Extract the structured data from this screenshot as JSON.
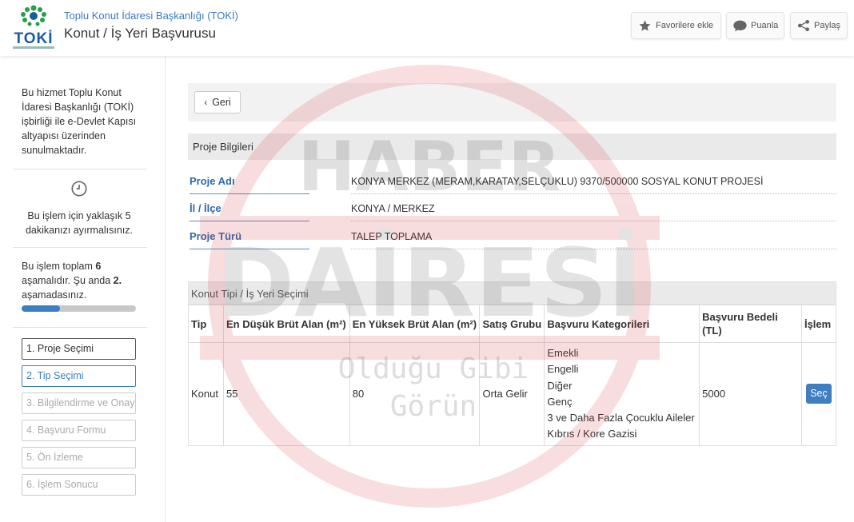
{
  "header": {
    "logo_text": "TOKİ",
    "org_name": "Toplu Konut İdaresi Başkanlığı (TOKİ)",
    "page_title": "Konut / İş Yeri Başvurusu",
    "buttons": {
      "favorite": "Favorilere ekle",
      "rate": "Puanla",
      "share": "Paylaş"
    }
  },
  "sidebar": {
    "service_info": "Bu hizmet Toplu Konut İdaresi Başkanlığı (TOKİ) işbirliği ile e-Devlet Kapısı altyapısı üzerinden sunulmaktadır.",
    "time_info": "Bu işlem için yaklaşık 5 dakikanızı ayırmalısınız.",
    "steps_text_prefix": "Bu işlem toplam ",
    "steps_total": "6",
    "steps_text_middle": " aşamalıdır. Şu anda ",
    "steps_current": "2.",
    "steps_text_suffix": " aşamadasınız.",
    "progress_fraction": 0.333,
    "steps": [
      {
        "label": "1. Proje Seçimi",
        "state": "done"
      },
      {
        "label": "2. Tip Seçimi",
        "state": "active"
      },
      {
        "label": "3. Bilgilendirme ve Onay",
        "state": "pending"
      },
      {
        "label": "4. Başvuru Formu",
        "state": "pending"
      },
      {
        "label": "5. Ön İzleme",
        "state": "pending"
      },
      {
        "label": "6. İşlem Sonucu",
        "state": "pending"
      }
    ]
  },
  "main": {
    "back_label": "Geri",
    "project_section_title": "Proje Bilgileri",
    "project": {
      "name_label": "Proje Adı",
      "name_value": "KONYA MERKEZ (MERAM,KARATAY,SELÇUKLU) 9370/500000 SOSYAL KONUT PROJESİ",
      "city_label": "İl / İlçe",
      "city_value": "KONYA / MERKEZ",
      "type_label": "Proje Türü",
      "type_value": "TALEP TOPLAMA"
    },
    "table_title": "Konut Tipi / İş Yeri Seçimi",
    "table": {
      "headers": [
        "Tip",
        "En Düşük Brüt Alan (m²)",
        "En Yüksek Brüt Alan (m²)",
        "Satış Grubu",
        "Başvuru Kategorileri",
        "Başvuru Bedeli (TL)",
        "İşlem"
      ],
      "rows": [
        {
          "tip": "Konut",
          "min_area": "55",
          "max_area": "80",
          "sales_group": "Orta Gelir",
          "categories": [
            "Emekli",
            "Engelli",
            "Diğer",
            "Genç",
            "3 ve Daha Fazla Çocuklu Aileler",
            "Kıbrıs / Kore Gazisi"
          ],
          "fee": "5000",
          "action": "Seç"
        }
      ]
    }
  },
  "watermark": {
    "line1": "HABER",
    "line2": "DAİRESİ",
    "line3": "Olduğu Gibi",
    "line4": "Görün"
  },
  "colors": {
    "accent": "#3a7fc3",
    "watermark": "#d9333a"
  }
}
